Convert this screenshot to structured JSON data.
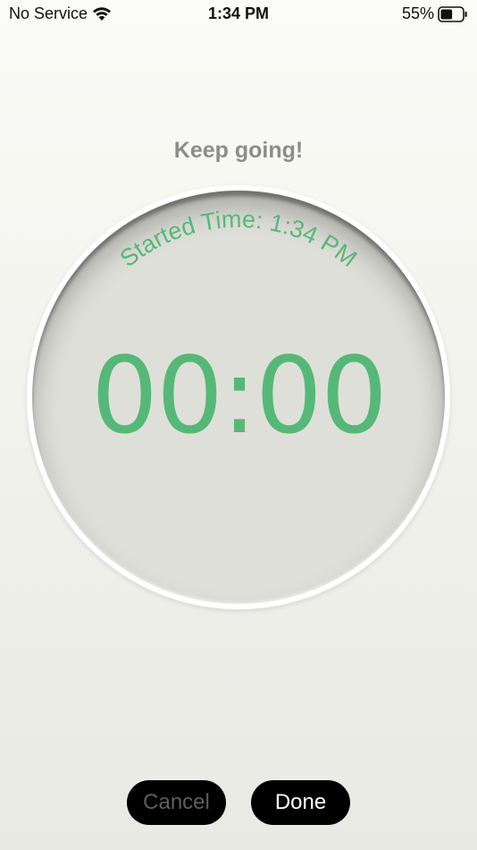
{
  "status_bar": {
    "carrier": "No Service",
    "wifi_icon": "wifi-icon",
    "time": "1:34 PM",
    "battery_percent": "55%",
    "battery_icon": "battery-icon",
    "battery_level": 0.55
  },
  "header": {
    "message": "Keep going!"
  },
  "timer": {
    "started_label": "Started Time: 1:34 PM",
    "elapsed": "00:00"
  },
  "actions": {
    "cancel_label": "Cancel",
    "done_label": "Done"
  },
  "colors": {
    "accent_green": "#56b878",
    "heading_gray": "#8c8c8c",
    "button_bg": "#000000",
    "disabled_text": "#5e5e5e"
  }
}
